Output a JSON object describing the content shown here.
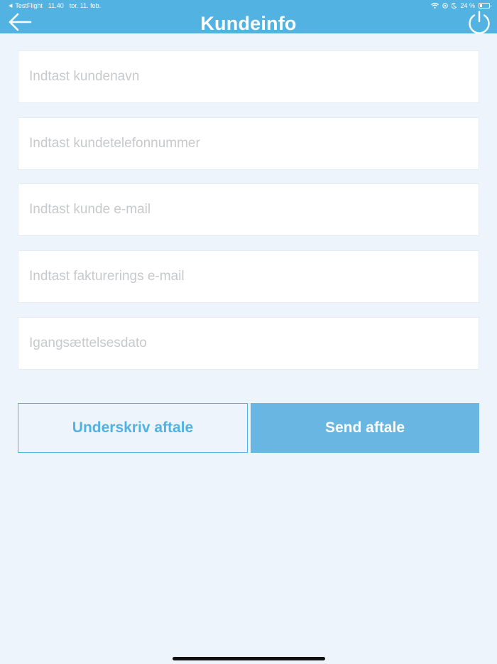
{
  "status_bar": {
    "back_app": "TestFlight",
    "time": "11.40",
    "date": "tor. 11. feb.",
    "battery": "24 %",
    "battery_level": 0.24
  },
  "nav": {
    "title": "Kundeinfo",
    "back_icon": "arrow-left-icon",
    "power_icon": "power-icon"
  },
  "form": {
    "fields": [
      {
        "placeholder": "Indtast kundenavn",
        "value": ""
      },
      {
        "placeholder": "Indtast kundetelefonnummer",
        "value": ""
      },
      {
        "placeholder": "Indtast kunde e-mail",
        "value": ""
      },
      {
        "placeholder": "Indtast fakturerings e-mail",
        "value": ""
      },
      {
        "placeholder": "Igangsættelsesdato",
        "value": ""
      }
    ]
  },
  "actions": {
    "sign_label": "Underskriv aftale",
    "send_label": "Send aftale"
  },
  "colors": {
    "header": "#52B3E3",
    "background": "#EDF4FB",
    "send_button": "#68B6E1"
  }
}
